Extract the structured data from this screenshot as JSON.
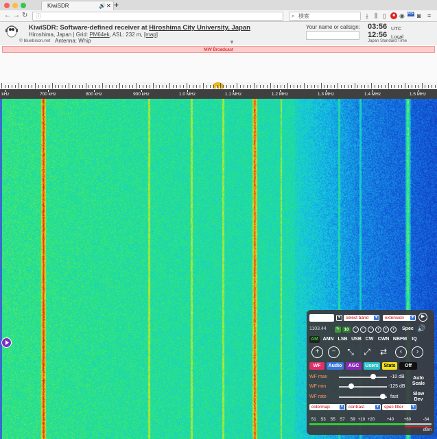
{
  "browser": {
    "tab_title": "KiwiSDR",
    "url": "",
    "search_placeholder": "検索",
    "toolbar_icons": [
      "back-icon",
      "forward-icon",
      "reload-icon",
      "info-icon",
      "overflow-icon",
      "pocket-icon",
      "bookmark-icon",
      "search-icon",
      "download-icon",
      "library-icon",
      "sidebar-icon",
      "stop-icon",
      "extension-icon",
      "camera-icon",
      "menu-icon"
    ]
  },
  "header": {
    "title_prefix": "KiwiSDR: Software-defined receiver at ",
    "title_link": "Hiroshima City University, Japan",
    "location_prefix": "Hiroshima, Japan | Grid: ",
    "grid": "PM64ek",
    "asl": ", ASL: 232 m, ",
    "map_link": "[map]",
    "credit": "© bluebison.net",
    "antenna": "Antenna: Whip",
    "callsign_label": "Your name or callsign:",
    "utc_time": "03:56",
    "utc_label": "UTC",
    "local_time": "12:56",
    "local_label": "Local",
    "timezone": "Japan Standard Time"
  },
  "band_bar": {
    "label": "MW Broadcast"
  },
  "scale": {
    "labels": [
      "kHz",
      "700 kHz",
      "800 kHz",
      "900 kHz",
      "1.0 MHz",
      "1.1 MHz",
      "1.2 MHz",
      "1.3 MHz",
      "1.4 MHz",
      "1.5 MHz"
    ]
  },
  "waterfall": {
    "strong_signals_khz": [
      700,
      1100,
      1390
    ],
    "weak_signals_khz": [
      900,
      980,
      1040,
      1150,
      1260,
      1300
    ]
  },
  "control": {
    "frequency": "",
    "freq_sub": "1103.44",
    "select_band": "select band",
    "extension": "extension",
    "step": "10",
    "spec": "Spec",
    "modes": [
      "AM",
      "AMN",
      "LSB",
      "USB",
      "CW",
      "CWN",
      "NBFM",
      "IQ"
    ],
    "active_mode": "AM",
    "tabs": [
      "WF",
      "Audio",
      "AGC",
      "Users",
      "Stats",
      "Off"
    ],
    "wf_max_label": "WF max",
    "wf_max_value": "-10 dB",
    "wf_max_level": 0.72,
    "wf_min_label": "WF min",
    "wf_min_value": "-125 dB",
    "wf_min_level": 0.26,
    "wf_rate_label": "WF rate",
    "wf_rate_value": "fast",
    "wf_rate_level": 0.92,
    "auto_scale": [
      "Auto",
      "Scale"
    ],
    "slow_dev": [
      "Slow",
      "Dev"
    ],
    "colormap": "colormap",
    "contrast": "contrast",
    "spec_filter": "spec filter",
    "smeter_labels": [
      "S1",
      "S3",
      "S5",
      "S7",
      "S9",
      "+10",
      "+20",
      "+40",
      "+60",
      "-34"
    ],
    "smeter_unit": "dBm",
    "smeter_level": 0.78,
    "accent": "#ff9966"
  }
}
